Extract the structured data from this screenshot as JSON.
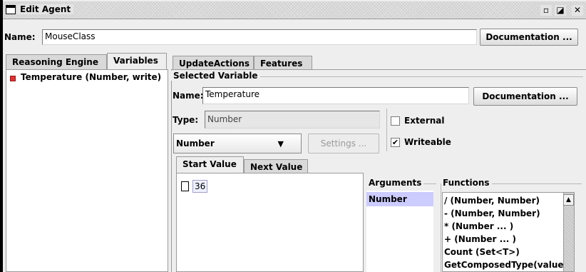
{
  "window": {
    "title": "Edit Agent",
    "controls": {
      "minimize": "▫",
      "maximize": "◪",
      "close": "✕"
    }
  },
  "agent": {
    "name_label": "Name:",
    "name_value": "MouseClass",
    "doc_button": "Documentation ..."
  },
  "left_tabs": [
    "Reasoning Engine",
    "Variables"
  ],
  "variables_list": [
    {
      "label": "Temperature (Number, write)",
      "bullet_color": "#e03030"
    }
  ],
  "right_tabs": [
    "UpdateActions",
    "Features"
  ],
  "selected_variable": {
    "group_title": "Selected Variable",
    "name_label": "Name:",
    "name_value": "Temperature",
    "doc_button": "Documentation ...",
    "type_label": "Type:",
    "type_value": "Number",
    "external_label": "External",
    "external_checked": false,
    "writeable_label": "Writeable",
    "writeable_checked": true,
    "type_combo": "Number",
    "settings_button": "Settings ..."
  },
  "value_tabs": [
    "Start Value",
    "Next Value"
  ],
  "start_value": {
    "value": "36"
  },
  "arguments": {
    "title": "Arguments",
    "items": [
      "Number"
    ]
  },
  "functions": {
    "title": "Functions",
    "items": [
      "/ (Number, Number)",
      "-  (Number, Number)",
      "* (Number ... )",
      "+ (Number ... )",
      "Count (Set<T>)",
      "GetComposedType(value"
    ]
  }
}
